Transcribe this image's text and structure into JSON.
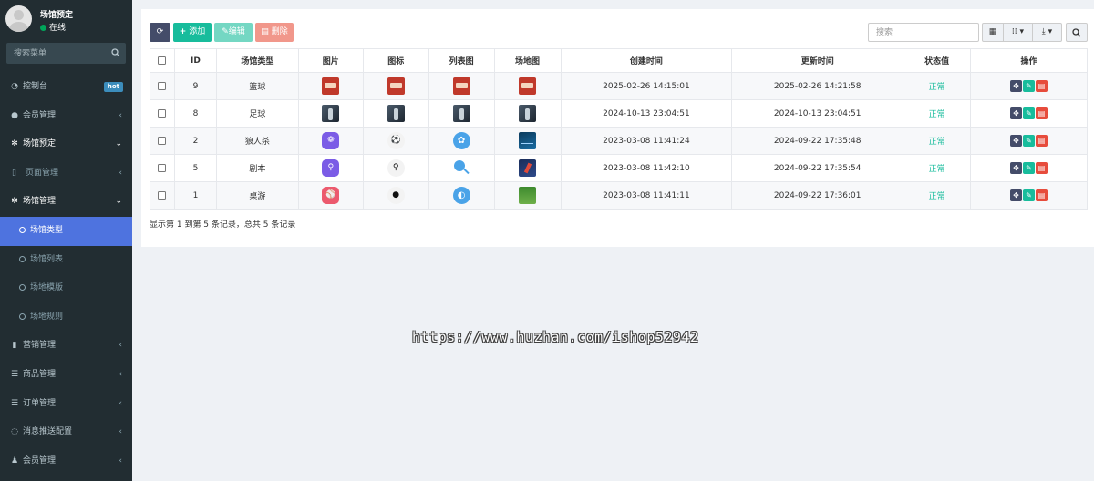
{
  "user": {
    "name": "场馆预定",
    "status": "在线"
  },
  "sidebar": {
    "search_placeholder": "搜索菜单",
    "items": [
      {
        "label": "控制台",
        "badge": "hot"
      },
      {
        "label": "会员管理"
      },
      {
        "label": "场馆预定"
      },
      {
        "label": "页面管理"
      },
      {
        "label": "场馆管理"
      },
      {
        "label": "场馆类型"
      },
      {
        "label": "场馆列表"
      },
      {
        "label": "场地模版"
      },
      {
        "label": "场地规则"
      },
      {
        "label": "营销管理"
      },
      {
        "label": "商品管理"
      },
      {
        "label": "订单管理"
      },
      {
        "label": "消息推送配置"
      },
      {
        "label": "会员管理"
      }
    ]
  },
  "toolbar": {
    "refresh_icon": "refresh-icon",
    "add_label": "添加",
    "edit_label": "编辑",
    "delete_label": "删除",
    "search_placeholder": "搜索"
  },
  "table": {
    "headers": [
      "ID",
      "场馆类型",
      "图片",
      "图标",
      "列表图",
      "场地图",
      "创建时间",
      "更新时间",
      "状态值",
      "操作"
    ],
    "rows": [
      {
        "id": "9",
        "type": "篮球",
        "created": "2025-02-26 14:15:01",
        "updated": "2025-02-26 14:21:58",
        "status": "正常"
      },
      {
        "id": "8",
        "type": "足球",
        "created": "2024-10-13 23:04:51",
        "updated": "2024-10-13 23:04:51",
        "status": "正常"
      },
      {
        "id": "2",
        "type": "狼人杀",
        "created": "2023-03-08 11:41:24",
        "updated": "2024-09-22 17:35:48",
        "status": "正常"
      },
      {
        "id": "5",
        "type": "剧本",
        "created": "2023-03-08 11:42:10",
        "updated": "2024-09-22 17:35:54",
        "status": "正常"
      },
      {
        "id": "1",
        "type": "桌游",
        "created": "2023-03-08 11:41:11",
        "updated": "2024-09-22 17:36:01",
        "status": "正常"
      }
    ]
  },
  "pagination": {
    "info": "显示第 1 到第 5 条记录，总共 5 条记录"
  },
  "watermark": "https://www.huzhan.com/ishop52942",
  "colors": {
    "sidebar_bg": "#222d32",
    "active": "#4e73df",
    "success": "#18bc9c",
    "danger": "#e74c3c",
    "primary_dark": "#444c69"
  }
}
